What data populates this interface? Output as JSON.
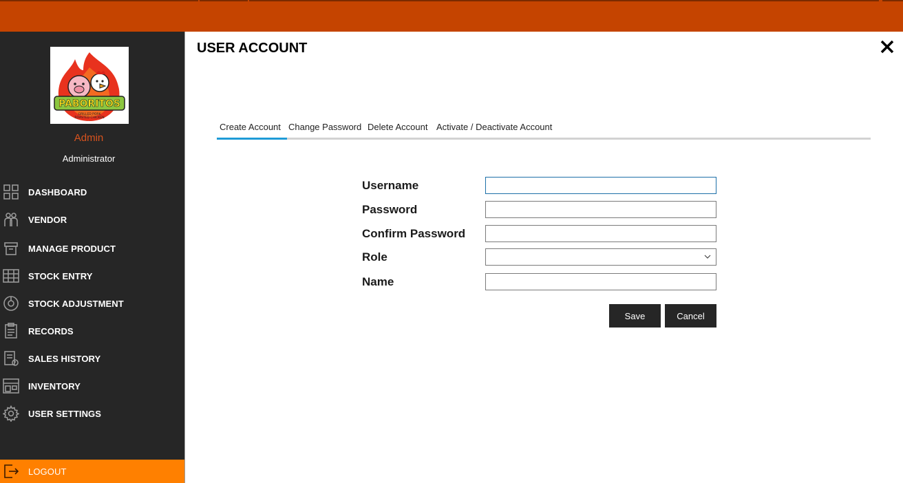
{
  "app": {
    "brand_text": "PABORITOS",
    "brand_sub1": "GRILLED PORK",
    "brand_sub2": "ROASTED CHICKEN"
  },
  "user": {
    "name": "Admin",
    "role": "Administrator"
  },
  "sidebar": {
    "items": [
      {
        "label": "DASHBOARD",
        "icon": "dashboard-icon"
      },
      {
        "label": "VENDOR",
        "icon": "vendor-icon"
      },
      {
        "label": "MANAGE PRODUCT",
        "icon": "box-icon"
      },
      {
        "label": "STOCK ENTRY",
        "icon": "stock-entry-icon"
      },
      {
        "label": "STOCK ADJUSTMENT",
        "icon": "stock-adjustment-icon"
      },
      {
        "label": "RECORDS",
        "icon": "records-icon"
      },
      {
        "label": "SALES HISTORY",
        "icon": "sales-history-icon"
      },
      {
        "label": "INVENTORY",
        "icon": "inventory-icon"
      },
      {
        "label": "USER SETTINGS",
        "icon": "gear-icon"
      }
    ],
    "logout_label": "LOGOUT"
  },
  "page": {
    "title": "USER ACCOUNT"
  },
  "tabs": [
    {
      "label": "Create Account",
      "active": true
    },
    {
      "label": "Change Password",
      "active": false
    },
    {
      "label": "Delete Account",
      "active": false
    },
    {
      "label": "Activate / Deactivate Account",
      "active": false
    }
  ],
  "form": {
    "username_label": "Username",
    "username_value": "",
    "password_label": "Password",
    "password_value": "",
    "confirm_label": "Confirm Password",
    "confirm_value": "",
    "role_label": "Role",
    "role_value": "",
    "name_label": "Name",
    "name_value": ""
  },
  "buttons": {
    "save": "Save",
    "cancel": "Cancel"
  },
  "colors": {
    "topbar": "#c54400",
    "sidebar": "#262626",
    "logout": "#ff8000",
    "accent_tab": "#1e9bd7",
    "admin_name": "#d9531e"
  }
}
